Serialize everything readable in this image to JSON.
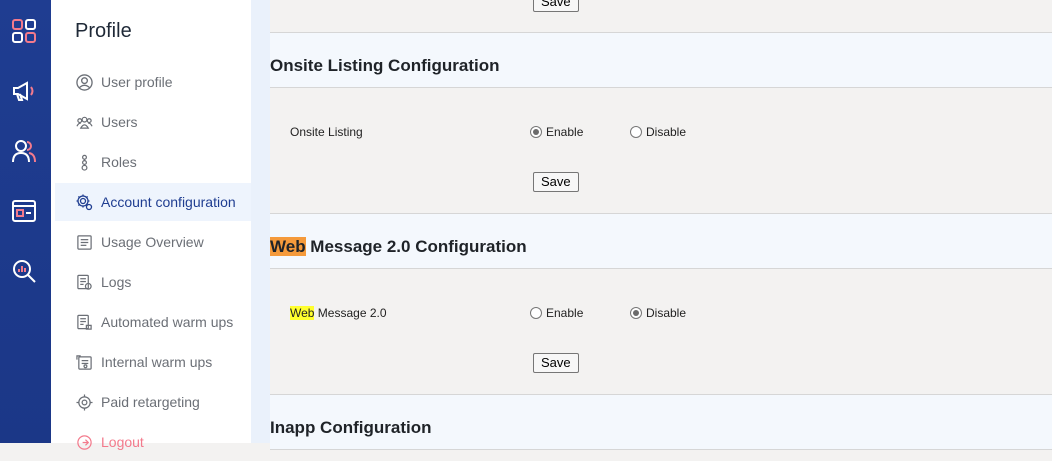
{
  "rail": {
    "icons": [
      "dashboard-icon",
      "megaphone-icon",
      "users-icon",
      "browser-window-icon",
      "analytics-search-icon"
    ]
  },
  "sidebar": {
    "title": "Profile",
    "items": [
      {
        "label": "User profile",
        "icon": "user-circle-icon"
      },
      {
        "label": "Users",
        "icon": "users-group-icon"
      },
      {
        "label": "Roles",
        "icon": "roles-icon"
      },
      {
        "label": "Account configuration",
        "icon": "gear-icon",
        "active": true
      },
      {
        "label": "Usage Overview",
        "icon": "document-icon"
      },
      {
        "label": "Logs",
        "icon": "logs-icon"
      },
      {
        "label": "Automated warm ups",
        "icon": "automated-icon"
      },
      {
        "label": "Internal warm ups",
        "icon": "internal-icon"
      },
      {
        "label": "Paid retargeting",
        "icon": "target-icon"
      },
      {
        "label": "Logout",
        "icon": "logout-icon"
      }
    ]
  },
  "main": {
    "top_save_label": "Save",
    "sections": [
      {
        "title": "Onsite Listing Configuration",
        "row_label": "Onsite Listing",
        "options": [
          "Enable",
          "Disable"
        ],
        "selected": "Enable",
        "save_label": "Save"
      },
      {
        "title_highlight": "Web",
        "title_rest": " Message 2.0 Configuration",
        "row_label_highlight": "Web",
        "row_label_rest": " Message 2.0",
        "options": [
          "Enable",
          "Disable"
        ],
        "selected": "Disable",
        "save_label": "Save"
      },
      {
        "title": "Inapp Configuration"
      }
    ]
  },
  "colors": {
    "rail": "#1f3d91",
    "accent": "#1f3d91",
    "icon_pink": "#f37a8c",
    "highlight_orange": "#f59a3b",
    "highlight_yellow": "#ffff2e"
  }
}
